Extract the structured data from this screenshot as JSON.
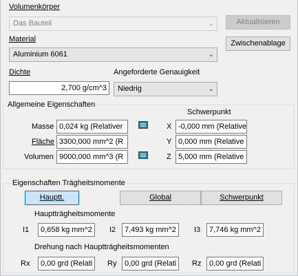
{
  "top": {
    "body_label": "Volumenkörper",
    "body_value": "Das Bauteil",
    "refresh_button": "Aktualisieren",
    "clipboard_button": "Zwischenablage",
    "material_label": "Material",
    "material_value": "Aluminium 6061",
    "density_label": "Dichte",
    "density_value": "2,700 g/cm^3",
    "accuracy_label": "Angeforderte Genauigkeit",
    "accuracy_value": "Niedrig"
  },
  "general": {
    "title": "Allgemeine Eigenschaften",
    "cog_title": "Schwerpunkt",
    "mass_label": "Masse",
    "mass_value": "0,024 kg (Relativer",
    "area_label": "Fläche",
    "area_value": "3300,000 mm^2 (R",
    "volume_label": "Volumen",
    "volume_value": "9000,000 mm^3 (R",
    "x_label": "X",
    "x_value": "-0,000 mm (Relative",
    "y_label": "Y",
    "y_value": "0,000 mm (Relative",
    "z_label": "Z",
    "z_value": "5,000 mm (Relative"
  },
  "inertia": {
    "title": "Eigenschaften Trägheitsmomente",
    "tab_principal": "Hauptt.",
    "tab_global": "Global",
    "tab_cog": "Schwerpunkt",
    "principal_title": "Hauptträgheitsmomente",
    "i1_label": "I1",
    "i1_value": "0,658 kg mm^2",
    "i2_label": "I2",
    "i2_value": "7,493 kg mm^2",
    "i3_label": "I3",
    "i3_value": "7,746 kg mm^2",
    "rotation_title": "Drehung nach Hauptträgheitsmomenten",
    "rx_label": "Rx",
    "rx_value": "0,00 grd (Relati",
    "ry_label": "Ry",
    "ry_value": "0,00 grd (Relati",
    "rz_label": "Rz",
    "rz_value": "0,00 grd (Relati"
  },
  "icons": {
    "copy": "copy-to-clipboard-icon",
    "dropdown": "chevron-down-icon"
  }
}
